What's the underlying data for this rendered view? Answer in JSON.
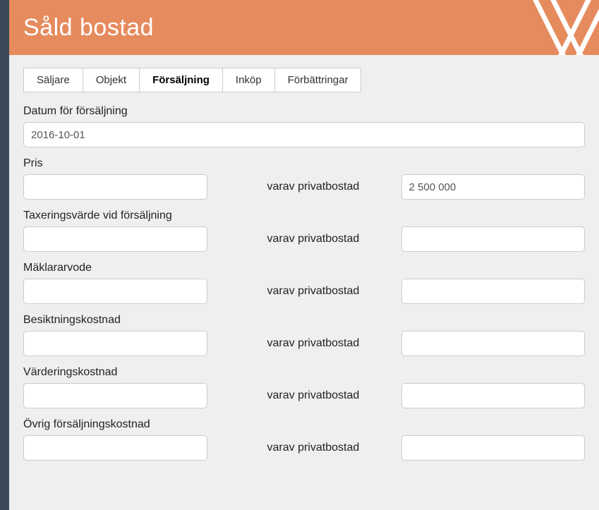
{
  "header": {
    "title": "Såld bostad"
  },
  "tabs": {
    "items": [
      {
        "label": "Säljare"
      },
      {
        "label": "Objekt"
      },
      {
        "label": "Försäljning"
      },
      {
        "label": "Inköp"
      },
      {
        "label": "Förbättringar"
      }
    ],
    "activeIndex": 2
  },
  "form": {
    "date_label": "Datum för försäljning",
    "date_value": "2016-10-01",
    "mid_label": "varav privatbostad",
    "rows": [
      {
        "label": "Pris",
        "left": "",
        "right": "2 500 000"
      },
      {
        "label": "Taxeringsvärde vid försäljning",
        "left": "",
        "right": ""
      },
      {
        "label": "Mäklararvode",
        "left": "",
        "right": ""
      },
      {
        "label": "Besiktningskostnad",
        "left": "",
        "right": ""
      },
      {
        "label": "Värderingskostnad",
        "left": "",
        "right": ""
      },
      {
        "label": "Övrig försäljningskostnad",
        "left": "",
        "right": ""
      }
    ]
  }
}
